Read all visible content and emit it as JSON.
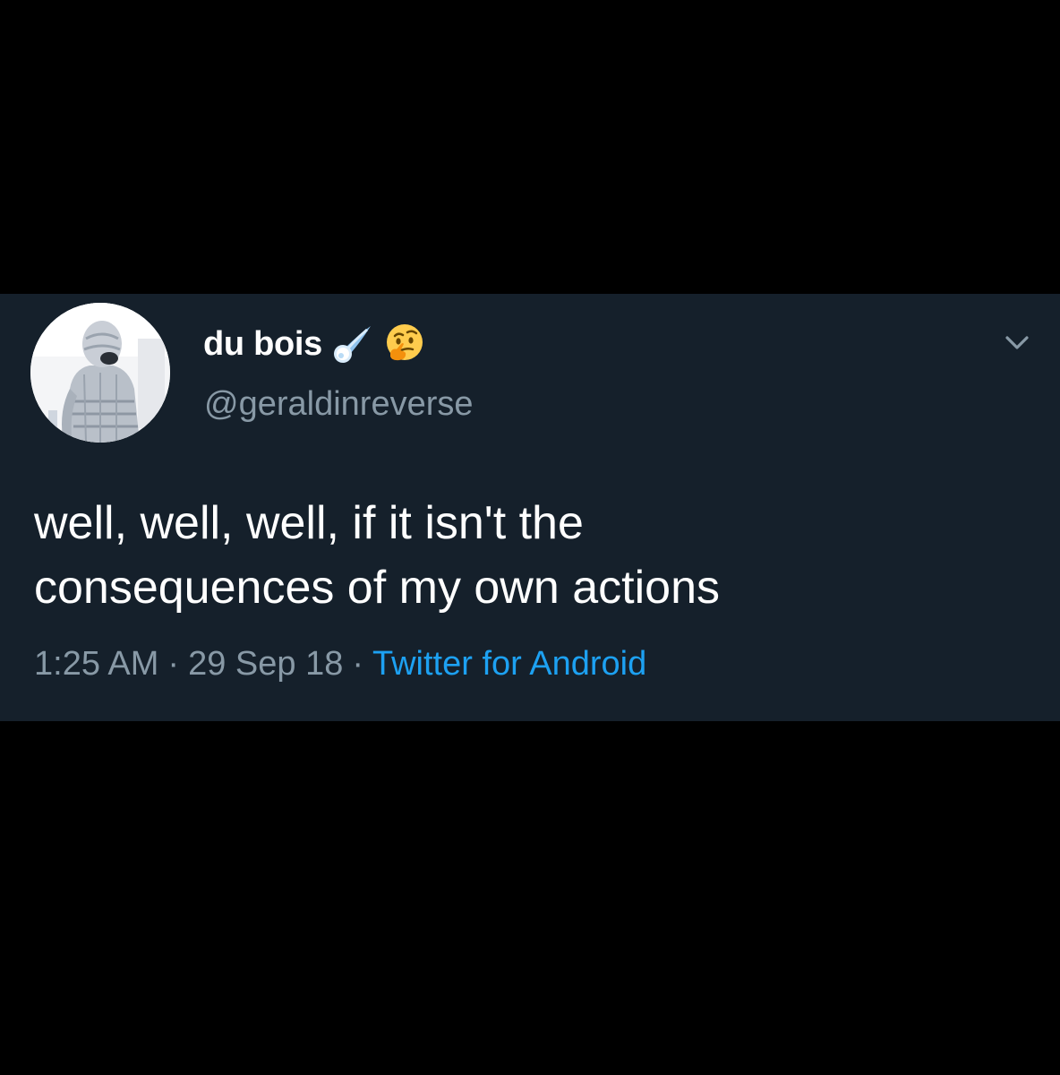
{
  "tweet": {
    "author": {
      "display_name": "du bois",
      "name_emojis": [
        "comet-icon",
        "thinking-face-icon"
      ],
      "handle": "@geraldinreverse"
    },
    "text_lines": [
      "well, well, well, if it isn't the",
      "consequences of my own actions"
    ],
    "meta": {
      "time": "1:25 AM",
      "separator": "·",
      "date": "29 Sep 18",
      "source": "Twitter for Android"
    },
    "menu_icon": "chevron-down-icon"
  },
  "colors": {
    "page_background": "#000000",
    "card_background": "#15202b",
    "primary_text": "#ffffff",
    "secondary_text": "#8899a6",
    "link": "#1da1f2"
  }
}
